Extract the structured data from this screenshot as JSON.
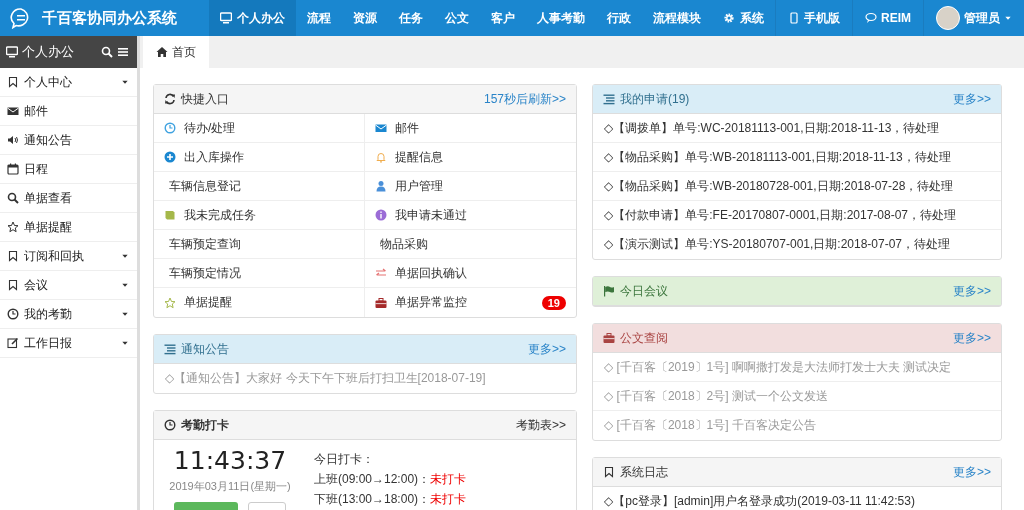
{
  "app": {
    "title": "千百客协同办公系统"
  },
  "nav": [
    {
      "label": "个人办公",
      "selected": true
    },
    {
      "label": "流程",
      "selected": false
    },
    {
      "label": "资源",
      "selected": false
    },
    {
      "label": "任务",
      "selected": false
    },
    {
      "label": "公文",
      "selected": false
    },
    {
      "label": "客户",
      "selected": false
    },
    {
      "label": "人事考勤",
      "selected": false
    },
    {
      "label": "行政",
      "selected": false
    },
    {
      "label": "流程模块",
      "selected": false
    },
    {
      "label": "系统",
      "selected": false
    }
  ],
  "nav_right": {
    "mobile": "手机版",
    "chat": "REIM",
    "user": "管理员"
  },
  "sidebar": {
    "title": "个人办公",
    "items": [
      {
        "label": "个人中心",
        "has_submenu": true
      },
      {
        "label": "邮件",
        "has_submenu": false
      },
      {
        "label": "通知公告",
        "has_submenu": false
      },
      {
        "label": "日程",
        "has_submenu": false
      },
      {
        "label": "单据查看",
        "has_submenu": false
      },
      {
        "label": "单据提醒",
        "has_submenu": false
      },
      {
        "label": "订阅和回执",
        "has_submenu": true
      },
      {
        "label": "会议",
        "has_submenu": true
      },
      {
        "label": "我的考勤",
        "has_submenu": true
      },
      {
        "label": "工作日报",
        "has_submenu": true
      }
    ]
  },
  "tabs": [
    {
      "label": "首页",
      "selected": true
    }
  ],
  "quick_entry": {
    "title": "快捷入口",
    "refresh": "157秒后刷新>>",
    "items": [
      {
        "label": "待办/处理"
      },
      {
        "label": "邮件"
      },
      {
        "label": "出入库操作"
      },
      {
        "label": "提醒信息"
      },
      {
        "label": "车辆信息登记"
      },
      {
        "label": "用户管理"
      },
      {
        "label": "我未完成任务"
      },
      {
        "label": "我申请未通过"
      },
      {
        "label": "车辆预定查询"
      },
      {
        "label": "物品采购"
      },
      {
        "label": "车辆预定情况"
      },
      {
        "label": "单据回执确认"
      },
      {
        "label": "单据提醒"
      },
      {
        "label": "单据异常监控",
        "badge": "19"
      }
    ]
  },
  "left_panels": [
    {
      "kind": "info",
      "title": "通知公告",
      "more": "更多>>",
      "items": [
        {
          "text": "◇【通知公告】大家好 今天下午下班后打扫卫生[2018-07-19]",
          "dimmed": true
        }
      ]
    }
  ],
  "attendance": {
    "title": "考勤打卡",
    "link": "考勤表>>",
    "time": "11:43:37",
    "date": "2019年03月11日(星期一)",
    "today": "今日打卡：",
    "shifts": [
      {
        "label": "上班(09:00→12:00)：",
        "status": "未打卡"
      },
      {
        "label": "下班(13:00→18:00)：",
        "status": "未打卡"
      }
    ]
  },
  "right_panels": [
    {
      "kind": "info",
      "title": "我的申请(19)",
      "more": "更多>>",
      "items": [
        {
          "text": "◇【调拨单】单号:WC-20181113-001,日期:2018-11-13，待处理",
          "dimmed": false
        },
        {
          "text": "◇【物品采购】单号:WB-20181113-001,日期:2018-11-13，待处理",
          "dimmed": false
        },
        {
          "text": "◇【物品采购】单号:WB-20180728-001,日期:2018-07-28，待处理",
          "dimmed": false
        },
        {
          "text": "◇【付款申请】单号:FE-20170807-0001,日期:2017-08-07，待处理",
          "dimmed": false
        },
        {
          "text": "◇【演示测试】单号:YS-20180707-001,日期:2018-07-07，待处理",
          "dimmed": false
        }
      ]
    },
    {
      "kind": "success",
      "title": "今日会议",
      "more": "更多>>"
    },
    {
      "kind": "danger",
      "title": "公文查阅",
      "more": "更多>>",
      "items": [
        {
          "text": "◇ [千百客〔2019〕1号] 啊啊撒打发是大法师打发士大夫 测试决定",
          "dimmed": true
        },
        {
          "text": "◇ [千百客〔2018〕2号] 测试一个公文发送",
          "dimmed": true
        },
        {
          "text": "◇ [千百客〔2018〕1号] 千百客决定公告",
          "dimmed": true
        }
      ]
    },
    {
      "kind": "default",
      "title": "系统日志",
      "more": "更多>>",
      "items": [
        {
          "text": "◇【pc登录】[admin]用户名登录成功(2019-03-11 11:42:53)",
          "dimmed": false
        }
      ]
    }
  ]
}
